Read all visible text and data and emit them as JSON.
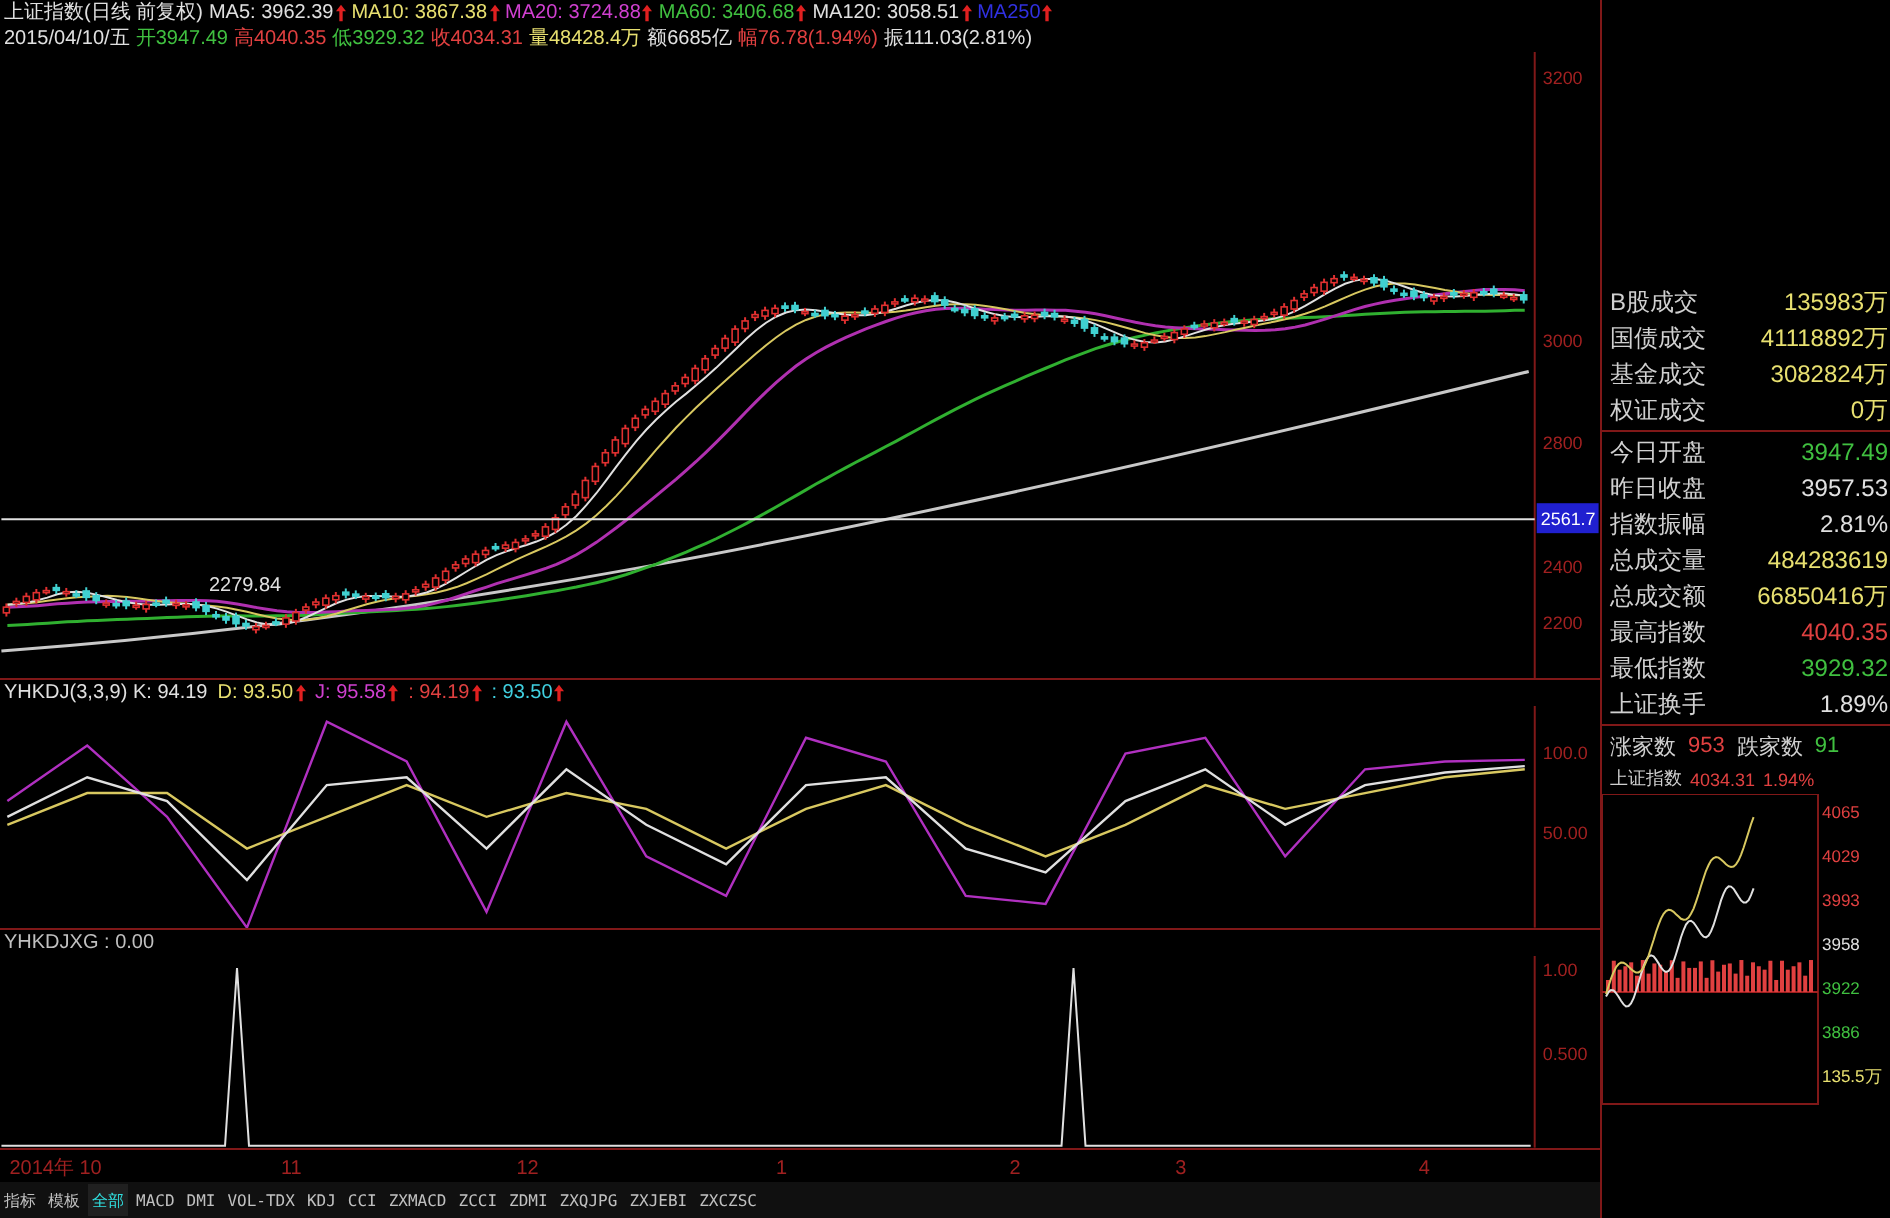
{
  "quote_header": {
    "lines": [
      [
        {
          "text": "上证指数(日线 前复权)",
          "color": "#e0e0e0",
          "arrow": false
        },
        {
          "text": "MA5: 3962.39",
          "color": "#e0e0e0",
          "arrow": true
        },
        {
          "text": "MA10: 3867.38",
          "color": "#e8e070",
          "arrow": true
        },
        {
          "text": "MA20: 3724.88",
          "color": "#d040d0",
          "arrow": true
        },
        {
          "text": "MA60: 3406.68",
          "color": "#40c040",
          "arrow": true
        },
        {
          "text": "MA120: 3058.51",
          "color": "#e0e0e0",
          "arrow": true
        },
        {
          "text": "MA250",
          "color": "#3030e0",
          "arrow": true
        }
      ],
      [
        {
          "text": "2015/04/10/五",
          "color": "#e0e0e0",
          "arrow": false
        },
        {
          "text": "开3947.49",
          "color": "#40c040",
          "arrow": false
        },
        {
          "text": "高4040.35",
          "color": "#e04040",
          "arrow": false
        },
        {
          "text": "低3929.32",
          "color": "#40c040",
          "arrow": false
        },
        {
          "text": "收4034.31",
          "color": "#e04040",
          "arrow": false
        },
        {
          "text": "量48428.4万",
          "color": "#e8e070",
          "arrow": false
        },
        {
          "text": "额6685亿",
          "color": "#e0e0e0",
          "arrow": false
        },
        {
          "text": "幅76.78(1.94%)",
          "color": "#e04040",
          "arrow": false
        },
        {
          "text": "振111.03(2.81%)",
          "color": "#e0e0e0",
          "arrow": false
        }
      ]
    ]
  },
  "main_chart": {
    "y_labels": [
      "3200",
      "3000",
      "2800",
      "2400",
      "2200"
    ],
    "cursor_value": "2561.7",
    "low_marker": "2279.84"
  },
  "kdj_panel": {
    "legend": [
      {
        "text": "YHKDJ(3,3,9) K: 94.19",
        "color": "#e0e0e0",
        "arrow": false
      },
      {
        "text": "D: 93.50",
        "color": "#e8e070",
        "arrow": true
      },
      {
        "text": "J: 95.58",
        "color": "#d040d0",
        "arrow": true
      },
      {
        "text": ": 94.19",
        "color": "#e04040",
        "arrow": true
      },
      {
        "text": ": 93.50",
        "color": "#40d0e0",
        "arrow": true
      }
    ],
    "chart_data": {
      "type": "line",
      "ylim": [
        -10,
        130
      ],
      "yticks": [
        {
          "value": 100,
          "label": "100.0"
        },
        {
          "value": 50,
          "label": "50.00"
        }
      ],
      "series": [
        {
          "color": "#e0e0e0",
          "values": [
            60,
            85,
            70,
            20,
            80,
            85,
            40,
            90,
            55,
            30,
            80,
            85,
            40,
            25,
            70,
            90,
            55,
            80,
            88,
            92
          ]
        },
        {
          "color": "#d8c860",
          "values": [
            55,
            75,
            75,
            40,
            60,
            80,
            60,
            75,
            65,
            40,
            65,
            80,
            55,
            35,
            55,
            80,
            65,
            75,
            85,
            90
          ]
        },
        {
          "color": "#b030c0",
          "values": [
            70,
            105,
            60,
            -10,
            120,
            95,
            0,
            120,
            35,
            10,
            110,
            95,
            10,
            5,
            100,
            110,
            35,
            90,
            95,
            96
          ]
        }
      ]
    }
  },
  "signal_panel": {
    "legend": "YHKDJXG : 0.00",
    "y_labels": [
      "1.00",
      "0.500"
    ]
  },
  "x_axis": [
    "2014年 10",
    "11",
    "12",
    "1",
    "2",
    "3",
    "4"
  ],
  "tabs": [
    {
      "label": "指标",
      "selected": false
    },
    {
      "label": "模板",
      "selected": false
    },
    {
      "label": "全部",
      "selected": true
    },
    {
      "label": "MACD",
      "selected": false
    },
    {
      "label": "DMI",
      "selected": false
    },
    {
      "label": "VOL-TDX",
      "selected": false
    },
    {
      "label": "KDJ",
      "selected": false
    },
    {
      "label": "CCI",
      "selected": false
    },
    {
      "label": "ZXMACD",
      "selected": false
    },
    {
      "label": "ZCCI",
      "selected": false
    },
    {
      "label": "ZDMI",
      "selected": false
    },
    {
      "label": "ZXQJPG",
      "selected": false
    },
    {
      "label": "ZXJEBI",
      "selected": false
    },
    {
      "label": "ZXCZSC",
      "selected": false
    }
  ],
  "side_panel": {
    "turnover_rows": [
      {
        "label": "B股成交",
        "value": "135983万",
        "color": "#e8e070"
      },
      {
        "label": "国债成交",
        "value": "41118892万",
        "color": "#e8e070"
      },
      {
        "label": "基金成交",
        "value": "3082824万",
        "color": "#e8e070"
      },
      {
        "label": "权证成交",
        "value": "0万",
        "color": "#e8e070"
      }
    ],
    "quote_rows": [
      {
        "label": "今日开盘",
        "value": "3947.49",
        "color": "#40c040"
      },
      {
        "label": "昨日收盘",
        "value": "3957.53",
        "color": "#e0e0e0"
      },
      {
        "label": "指数振幅",
        "value": "2.81%",
        "color": "#e0e0e0"
      },
      {
        "label": "总成交量",
        "value": "484283619",
        "color": "#e8e070"
      },
      {
        "label": "总成交额",
        "value": "66850416万",
        "color": "#e8e070"
      },
      {
        "label": "最高指数",
        "value": "4040.35",
        "color": "#e04040"
      },
      {
        "label": "最低指数",
        "value": "3929.32",
        "color": "#40c040"
      },
      {
        "label": "上证换手",
        "value": "1.89%",
        "color": "#e0e0e0"
      }
    ],
    "breadth": {
      "up_label": "涨家数",
      "up_value": "953",
      "down_label": "跌家数",
      "down_value": "91"
    },
    "mini_chart": {
      "title": "上证指数",
      "price": "4034.31",
      "change": "1.94%",
      "labels": [
        {
          "text": "4065",
          "color": "#e04040"
        },
        {
          "text": "4029",
          "color": "#e04040"
        },
        {
          "text": "3993",
          "color": "#e04040"
        },
        {
          "text": "3958",
          "color": "#e0e0e0"
        },
        {
          "text": "3922",
          "color": "#40c040"
        },
        {
          "text": "3886",
          "color": "#40c040"
        },
        {
          "text": "135.5万",
          "color": "#e8e070"
        }
      ]
    }
  }
}
